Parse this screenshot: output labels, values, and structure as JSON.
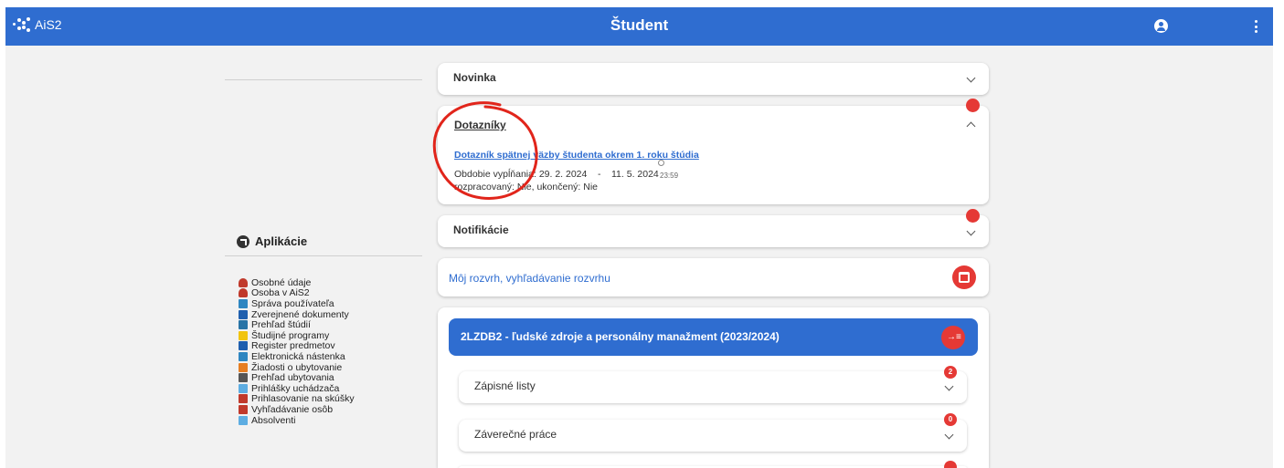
{
  "topbar": {
    "logo_text": "AiS2",
    "title": "Študent",
    "accent_color": "#2f6dd0",
    "user_icon": "account-circle-icon",
    "menu_icon": "more-vertical-icon"
  },
  "sidebar": {
    "apps_title": "Aplikácie",
    "items": [
      {
        "label": "Osobné údaje",
        "icon": "person-icon",
        "color": "#c0392b"
      },
      {
        "label": "Osoba v AiS2",
        "icon": "person-icon",
        "color": "#c0392b"
      },
      {
        "label": "Správa používateľa",
        "icon": "users-tree-icon",
        "color": "#2e86c1"
      },
      {
        "label": "Zverejnené dokumenty",
        "icon": "document-icon",
        "color": "#1f5fae"
      },
      {
        "label": "Prehľad štúdií",
        "icon": "list-icon",
        "color": "#2874a6"
      },
      {
        "label": "Študijné programy",
        "icon": "list-icon",
        "color": "#f1c40f"
      },
      {
        "label": "Register predmetov",
        "icon": "folder-icon",
        "color": "#1f5fae"
      },
      {
        "label": "Elektronická nástenka",
        "icon": "board-icon",
        "color": "#2e86c1"
      },
      {
        "label": "Žiadosti o ubytovanie",
        "icon": "dorm-request-icon",
        "color": "#e67e22"
      },
      {
        "label": "Prehľad ubytovania",
        "icon": "grid-dots-icon",
        "color": "#555555"
      },
      {
        "label": "Prihlášky uchádzača",
        "icon": "application-icon",
        "color": "#5dade2"
      },
      {
        "label": "Prihlasovanie na skúšky",
        "icon": "exam-icon",
        "color": "#c0392b"
      },
      {
        "label": "Vyhľadávanie osôb",
        "icon": "people-search-icon",
        "color": "#c0392b"
      },
      {
        "label": "Absolventi",
        "icon": "graduates-icon",
        "color": "#5dade2"
      }
    ]
  },
  "cards": {
    "novinka": {
      "title": "Novinka"
    },
    "dotazniky": {
      "title": "Dotazníky",
      "link": "Dotazník spätnej väzby študenta okrem 1. roku štúdia",
      "period_label": "Obdobie vypĺňania: 29. 2. 2024",
      "period_sep": "-",
      "period_end": "11. 5. 2024",
      "period_time": "23:59",
      "status": "rozpracovaný: Nie, ukončený: Nie"
    },
    "notifikacie": {
      "title": "Notifikácie"
    },
    "rozvrh": {
      "title": "Môj rozvrh, vyhľadávanie rozvrhu"
    }
  },
  "program": {
    "title": "2LZDB2 - ľudské zdroje a personálny manažment (2023/2024)",
    "sections": [
      {
        "title": "Zápisné listy",
        "badge": "2"
      },
      {
        "title": "Záverečné práce",
        "badge": "0"
      }
    ]
  }
}
